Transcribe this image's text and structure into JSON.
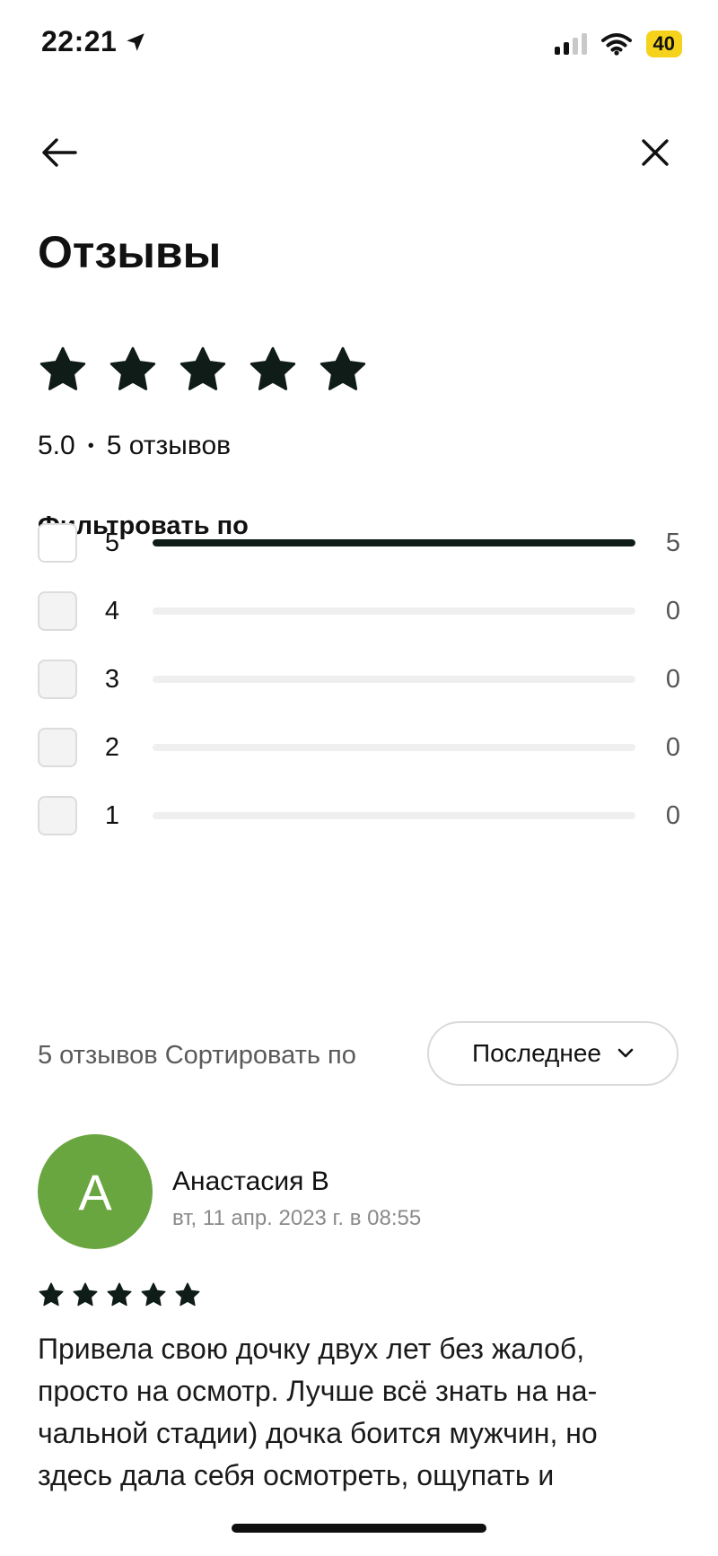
{
  "status_bar": {
    "time": "22:21",
    "battery": "40",
    "location_icon": "location-arrow-icon",
    "signal_icon": "cellular-signal-icon",
    "wifi_icon": "wifi-icon"
  },
  "nav": {
    "back_icon": "arrow-left-icon",
    "close_icon": "close-icon"
  },
  "title": "Отзывы",
  "summary": {
    "stars": 5,
    "rating": "5.0",
    "separator": "•",
    "reviews_count": "5 отзывов"
  },
  "filter": {
    "title": "Фильтровать по",
    "rows": [
      {
        "label": "5",
        "count": "5",
        "fraction": 1.0,
        "checkbox_white": true
      },
      {
        "label": "4",
        "count": "0",
        "fraction": 0.0,
        "checkbox_white": false
      },
      {
        "label": "3",
        "count": "0",
        "fraction": 0.0,
        "checkbox_white": false
      },
      {
        "label": "2",
        "count": "0",
        "fraction": 0.0,
        "checkbox_white": false
      },
      {
        "label": "1",
        "count": "0",
        "fraction": 0.0,
        "checkbox_white": false
      }
    ]
  },
  "sort": {
    "count_label": "5 отзывов",
    "sort_label": "Сортировать по",
    "selected": "Последнее"
  },
  "review": {
    "avatar_letter": "A",
    "avatar_color": "#6aa640",
    "name": "Анастасия В",
    "date": "вт, 11 апр. 2023 г. в 08:55",
    "stars": 5,
    "text_lines": [
      "Привела свою дочку двух лет без жалоб,",
      "просто на осмотр. Лучше всё знать на на-",
      "чальной стадии) дочка боится мужчин, но",
      "здесь дала себя осмотреть, ощупать и"
    ]
  }
}
